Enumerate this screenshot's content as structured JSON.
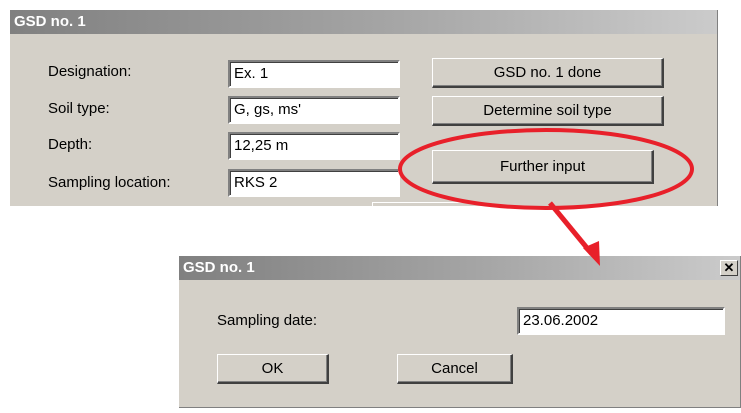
{
  "main_dialog": {
    "title": "GSD no. 1",
    "fields": [
      {
        "label": "Designation:",
        "value": "Ex. 1"
      },
      {
        "label": "Soil type:",
        "value": "G, gs, ms'"
      },
      {
        "label": "Depth:",
        "value": "12,25 m"
      },
      {
        "label": "Sampling location:",
        "value": "RKS 2"
      }
    ],
    "buttons": {
      "done": "GSD no. 1 done",
      "determine": "Determine soil type",
      "further": "Further input"
    }
  },
  "sub_dialog": {
    "title": "GSD no. 1",
    "close_glyph": "✕",
    "sampling_date_label": "Sampling date:",
    "sampling_date_value": "23.06.2002",
    "ok_label": "OK",
    "cancel_label": "Cancel"
  },
  "annotation": {
    "color": "#e8202a"
  }
}
